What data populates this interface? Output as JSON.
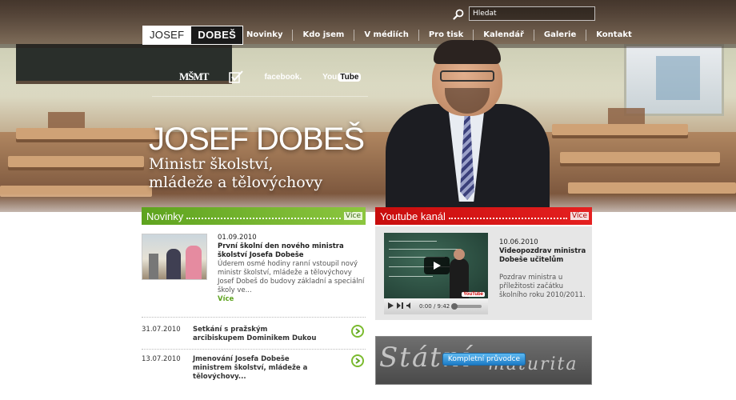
{
  "header": {
    "logo_first": "JOSEF",
    "logo_last": "DOBEŠ",
    "search_placeholder": "Hledat",
    "nav": [
      "Novinky",
      "Kdo jsem",
      "V médiích",
      "Pro tisk",
      "Kalendář",
      "Galerie",
      "Kontakt"
    ]
  },
  "social": {
    "msmt": "MŠMT",
    "facebook": "facebook.",
    "youtube_you": "You",
    "youtube_tube": "Tube"
  },
  "hero": {
    "name": "JOSEF DOBEŠ",
    "subtitle_line1": "Ministr školství,",
    "subtitle_line2": "mládeže a tělovýchovy"
  },
  "news": {
    "title": "Novinky",
    "more": "Více",
    "feature": {
      "date": "01.09.2010",
      "title": "První školní den nového ministra školství Josefa Dobeše",
      "body": "Úderem osmé hodiny ranní vstoupil nový ministr školství, mládeže a tělovýchovy Josef Dobeš do budovy základní a speciální školy ve...",
      "more": "Více"
    },
    "items": [
      {
        "date": "31.07.2010",
        "title": "Setkání s pražským arcibiskupem Dominikem Dukou"
      },
      {
        "date": "13.07.2010",
        "title": "Jmenování Josefa Dobeše ministrem školství, mládeže a tělovýchovy..."
      }
    ]
  },
  "youtube": {
    "title": "Youtube kanál",
    "more": "Více",
    "video_time": "0:00 / 9:42",
    "video_logo": "YouTube",
    "date": "10.06.2010",
    "video_title": "Videopozdrav ministra Dobeše učitelům",
    "description": "Pozdrav ministra u příležitosti začátku školního roku 2010/2011."
  },
  "matura": {
    "scribble_1": "Státní",
    "scribble_2": "maturita",
    "button": "Kompletní průvodce"
  },
  "colors": {
    "green": "#6fb12a",
    "red": "#d91414",
    "blue_button": "#2a8ad6"
  }
}
